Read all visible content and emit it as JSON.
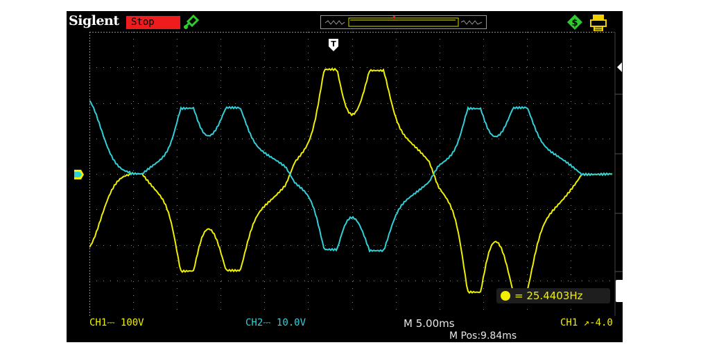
{
  "header": {
    "brand": "Siglent",
    "status": "Stop",
    "icons": [
      "usb-icon",
      "memory-depth-bar",
      "network-icon",
      "printer-icon"
    ]
  },
  "markers": {
    "trigger_position": "T"
  },
  "footer": {
    "ch1": "CH1⎓ 100V",
    "ch2": "CH2⎓ 10.0V",
    "timebase": "M 5.00ms",
    "mpos": "M Pos:9.84ms",
    "trigger": "CH1 ↗-4.0"
  },
  "measurement": {
    "frequency": "= 25.4403Hz"
  },
  "colors": {
    "ch1": "#f0f000",
    "ch2": "#31d0d8",
    "stop": "#ee1c1c",
    "grid": "#8a8a8a",
    "icon_green": "#2fcc2f"
  }
}
